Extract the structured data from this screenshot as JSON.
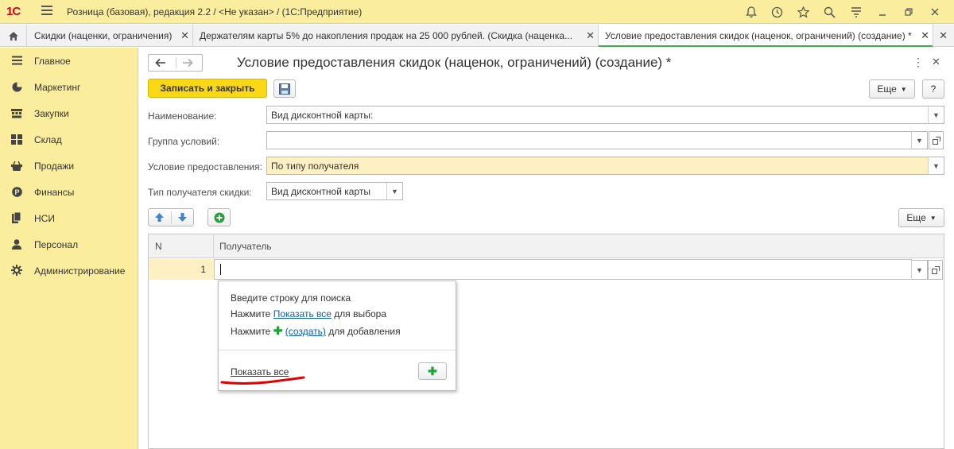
{
  "app": {
    "logo": "1С",
    "title": "Розница (базовая), редакция 2.2 / <Не указан> /  (1С:Предприятие)"
  },
  "titlebar_icons": [
    "bell-icon",
    "history-icon",
    "star-icon",
    "search-icon",
    "settings-icon",
    "minimize-icon",
    "restore-icon",
    "close-icon"
  ],
  "tabs": [
    {
      "label": "Скидки (наценки, ограничения)",
      "active": false
    },
    {
      "label": "Держателям карты 5% до накопления продаж на 25 000 рублей. (Скидка (наценка...",
      "active": false
    },
    {
      "label": "Условие предоставления скидок (наценок, ограничений) (создание) *",
      "active": true
    }
  ],
  "sidebar": {
    "items": [
      {
        "label": "Главное",
        "icon": "menu-icon"
      },
      {
        "label": "Маркетинг",
        "icon": "marketing-icon"
      },
      {
        "label": "Закупки",
        "icon": "purchases-icon"
      },
      {
        "label": "Склад",
        "icon": "warehouse-icon"
      },
      {
        "label": "Продажи",
        "icon": "sales-icon"
      },
      {
        "label": "Финансы",
        "icon": "finance-icon"
      },
      {
        "label": "НСИ",
        "icon": "reference-icon"
      },
      {
        "label": "Персонал",
        "icon": "person-icon"
      },
      {
        "label": "Администрирование",
        "icon": "gear-icon"
      }
    ]
  },
  "form": {
    "title": "Условие предоставления скидок (наценок, ограничений) (создание) *",
    "save_close_label": "Записать и закрыть",
    "more_label": "Еще",
    "help_label": "?",
    "fields": {
      "name_label": "Наименование:",
      "name_value": "Вид дисконтной карты:",
      "group_label": "Группа условий:",
      "group_value": "",
      "condition_label": "Условие предоставления:",
      "condition_value": "По типу получателя",
      "recipient_type_label": "Тип получателя скидки:",
      "recipient_type_value": "Вид дисконтной карты"
    },
    "table_more_label": "Еще",
    "table": {
      "columns": [
        "N",
        "Получатель"
      ],
      "rows": [
        {
          "n": "1",
          "recipient": ""
        }
      ]
    }
  },
  "popup": {
    "line1": "Введите строку для поиска",
    "line2_prefix": "Нажмите ",
    "line2_link": "Показать все",
    "line2_suffix": " для выбора",
    "line3_prefix": "Нажмите ",
    "line3_plus": "✚",
    "line3_link": "(создать)",
    "line3_suffix": " для добавления",
    "show_all_link": "Показать все",
    "add_button": "✚"
  },
  "colors": {
    "accent_yellow": "#fbed9e",
    "primary_button": "#fad814",
    "active_tab_underline": "#3cb04a",
    "link": "#0560b0",
    "annotation_red": "#e00000"
  }
}
